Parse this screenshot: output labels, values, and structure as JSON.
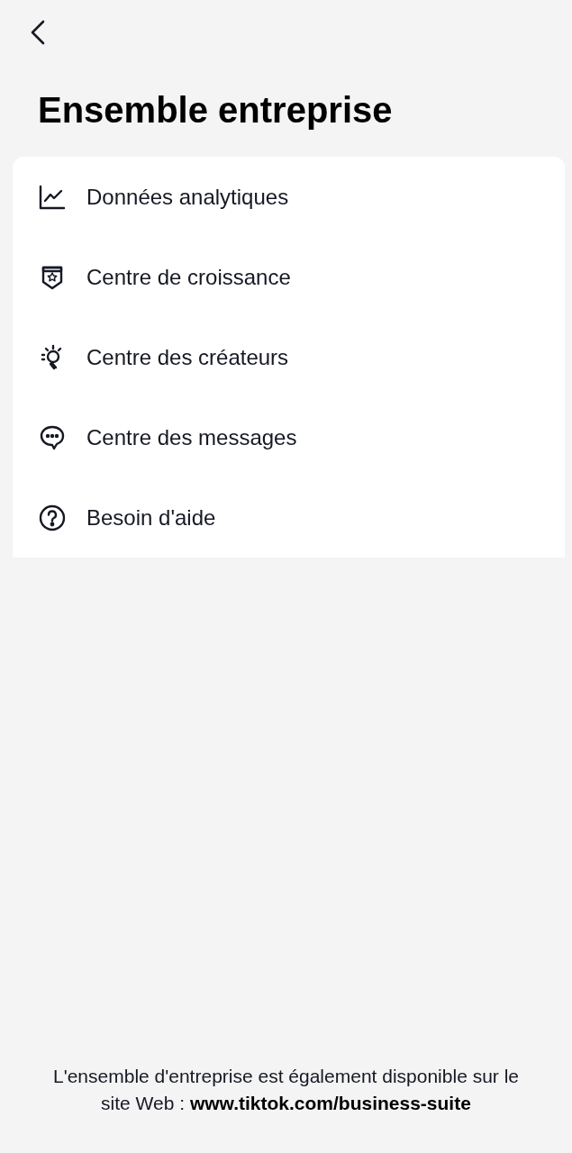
{
  "header": {
    "title": "Ensemble entreprise"
  },
  "menu": [
    {
      "kind": "analytics",
      "label": "Données analytiques"
    },
    {
      "kind": "growth",
      "label": "Centre de croissance"
    },
    {
      "kind": "creator",
      "label": "Centre des créateurs"
    },
    {
      "kind": "messages",
      "label": "Centre des messages"
    },
    {
      "kind": "help",
      "label": "Besoin d'aide"
    }
  ],
  "footer": {
    "text": "L'ensemble d'entreprise est également disponible sur le site Web :",
    "link": "www.tiktok.com/business-suite"
  }
}
